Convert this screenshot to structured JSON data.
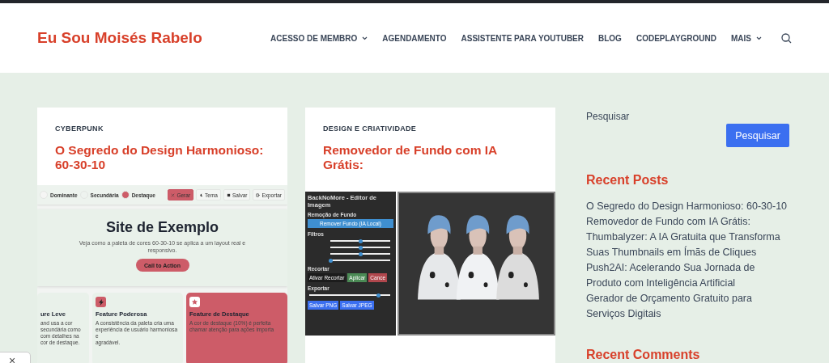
{
  "site_title": "Eu Sou Moisés Rabelo",
  "nav": [
    {
      "label": "ACESSO DE MEMBRO",
      "has_menu": true
    },
    {
      "label": "AGENDAMENTO",
      "has_menu": false
    },
    {
      "label": "ASSISTENTE PARA YOUTUBER",
      "has_menu": false
    },
    {
      "label": "BLOG",
      "has_menu": false
    },
    {
      "label": "CODEPLAYGROUND",
      "has_menu": false
    },
    {
      "label": "MAIS",
      "has_menu": true
    }
  ],
  "posts": [
    {
      "category": "CYBERPUNK",
      "title": "O Segredo do Design Harmonioso: 60-30-10",
      "preview": {
        "kind": "palette-site",
        "swatches": [
          {
            "name": "Dominante",
            "color": "#f5f5f4"
          },
          {
            "name": "Secundária",
            "color": "#eef3ef"
          },
          {
            "name": "Destaque",
            "color": "#cd5c68"
          }
        ],
        "actions": [
          {
            "label": "Gerar",
            "kind": "primary"
          },
          {
            "label": "Tema",
            "kind": "moon"
          },
          {
            "label": "Salvar",
            "kind": "save"
          },
          {
            "label": "Exportar",
            "kind": "export"
          }
        ],
        "hero_title": "Site de Exemplo",
        "hero_text": "Veja como a paleta de cores 60-30-10 se aplica a um layout real e responsivo.",
        "cta": "Call to Action",
        "features": [
          {
            "title": "ure Leve",
            "lines": [
              "and usa a cor secundária como",
              "com detalhes na cor de destaque."
            ],
            "highlight": false
          },
          {
            "title": "Feature Poderosa",
            "lines": [
              "A consistência da paleta cria uma",
              "experiência de usuário harmoniosa e",
              "agradável."
            ],
            "highlight": false
          },
          {
            "title": "Feature de Destaque",
            "lines": [
              "A cor de destaque (10%) é perfeita",
              "chamar atenção para ações importa"
            ],
            "highlight": true
          }
        ]
      }
    },
    {
      "category": "DESIGN E CRIATIVIDADE",
      "title": "Removedor de Fundo com IA Grátis:",
      "preview": {
        "kind": "editor",
        "app_title": "BackNoMore - Editor de Imagem",
        "section_remove": "Remoção de Fundo",
        "remove_button": "Remover Fundo (IA Local)",
        "section_filters": "Filtros",
        "filters": [
          {
            "level": 0.5
          },
          {
            "level": 0.5
          },
          {
            "level": 0.5
          },
          {
            "level": 0.0
          }
        ],
        "section_crop": "Recortar",
        "crop_buttons": [
          {
            "label": "Ativar Recortar",
            "kind": "dark"
          },
          {
            "label": "Aplicar",
            "kind": "green"
          },
          {
            "label": "Cance",
            "kind": "red"
          }
        ],
        "section_export": "Exportar",
        "quality": {
          "level": 0.85
        },
        "export_buttons": [
          "Salvar PNG",
          "Salvar JPEG"
        ]
      }
    }
  ],
  "sidebar": {
    "search_label": "Pesquisar",
    "search_button": "Pesquisar",
    "recent_posts_title": "Recent Posts",
    "recent_posts": [
      "O Segredo do Design Harmonioso: 60-30-10",
      "Removedor de Fundo com IA Grátis:",
      "Thumbalyzer: A IA Gratuita que Transforma Suas Thumbnails em Ímãs de Cliques",
      "Push2AI: Acelerando Sua Jornada de Produto com Inteligência Artificial",
      "Gerador de Orçamento Gratuito para Serviços Digitais"
    ],
    "recent_comments_title": "Recent Comments"
  },
  "popup": {
    "close": "×"
  }
}
